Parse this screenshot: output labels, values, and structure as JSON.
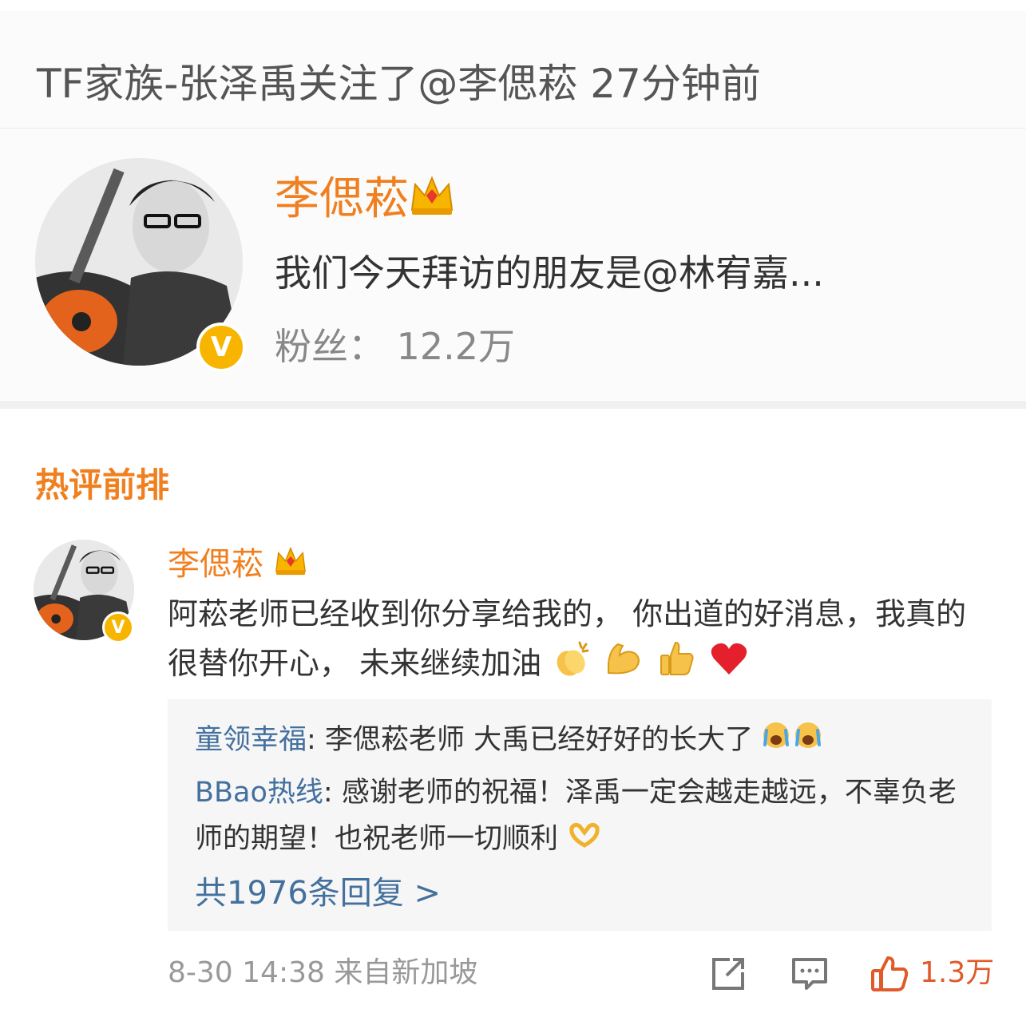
{
  "notice": {
    "text": "TF家族-张泽禹关注了@李偲菘 27分钟前"
  },
  "user_card": {
    "name": "李偲菘",
    "description": "我们今天拜访的朋友是@林宥嘉...",
    "fans_label": "粉丝：",
    "fans_count": "12.2万",
    "verified_badge": "V"
  },
  "hot_comments": {
    "title": "热评前排",
    "comment": {
      "author": "李偲菘",
      "text": "阿菘老师已经收到你分享给我的， 你出道的好消息，我真的很替你开心， 未来继续加油",
      "replies": [
        {
          "author": "童领幸福",
          "text": "李偲菘老师  大禹已经好好的长大了"
        },
        {
          "author": "BBao热线",
          "text": "感谢老师的祝福！泽禹一定会越走越远，不辜负老师的期望！也祝老师一切顺利"
        }
      ],
      "more_replies": "共1976条回复 >",
      "timestamp": "8-30 14:38",
      "source": "来自新加坡",
      "like_count": "1.3万"
    }
  },
  "colors": {
    "accent_orange": "#f07f1f",
    "link_blue": "#44709e",
    "badge_gold": "#f7b500"
  }
}
